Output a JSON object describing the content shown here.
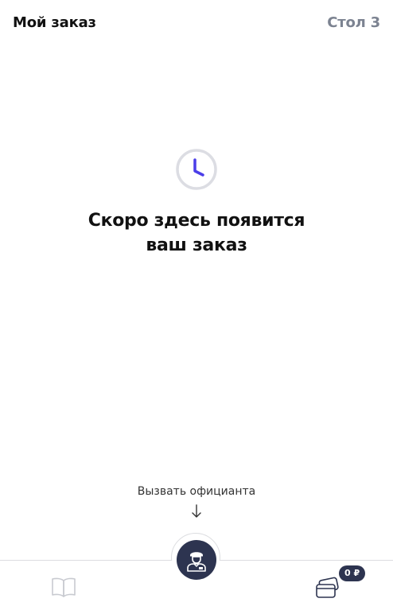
{
  "header": {
    "title": "Мой заказ",
    "table": "Стол 3"
  },
  "empty_state": {
    "icon": "clock-icon",
    "line1": "Скоро здесь появится",
    "line2": "ваш заказ"
  },
  "call_waiter": {
    "label": "Вызвать официанта",
    "arrow_icon": "arrow-down-icon",
    "button_icon": "waiter-icon"
  },
  "bottom_nav": {
    "menu_icon": "open-book-icon",
    "payment_icon": "credit-card-icon",
    "badge": "0 ₽"
  },
  "colors": {
    "accent": "#4b3ee8",
    "dark": "#2d3450",
    "muted": "#7c8391"
  }
}
